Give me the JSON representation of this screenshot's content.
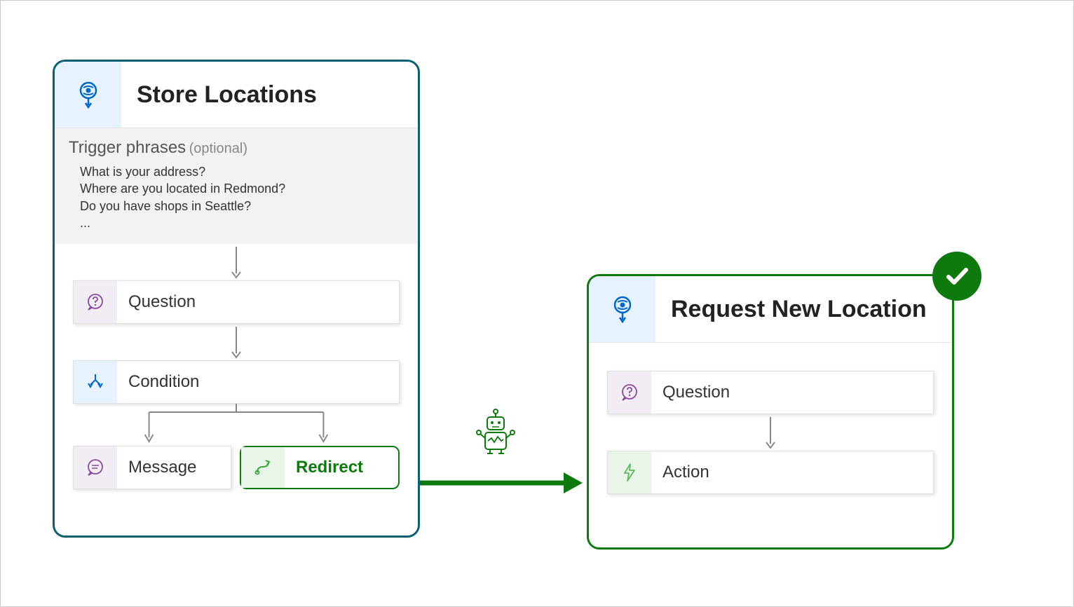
{
  "left_topic": {
    "title": "Store Locations",
    "trigger_label": "Trigger phrases",
    "trigger_optional": "(optional)",
    "phrases": [
      "What is your address?",
      "Where are you located in Redmond?",
      "Do you have shops in Seattle?",
      "..."
    ],
    "nodes": {
      "question": "Question",
      "condition": "Condition",
      "message": "Message",
      "redirect": "Redirect"
    }
  },
  "right_topic": {
    "title": "Request New Location",
    "nodes": {
      "question": "Question",
      "action": "Action"
    }
  }
}
